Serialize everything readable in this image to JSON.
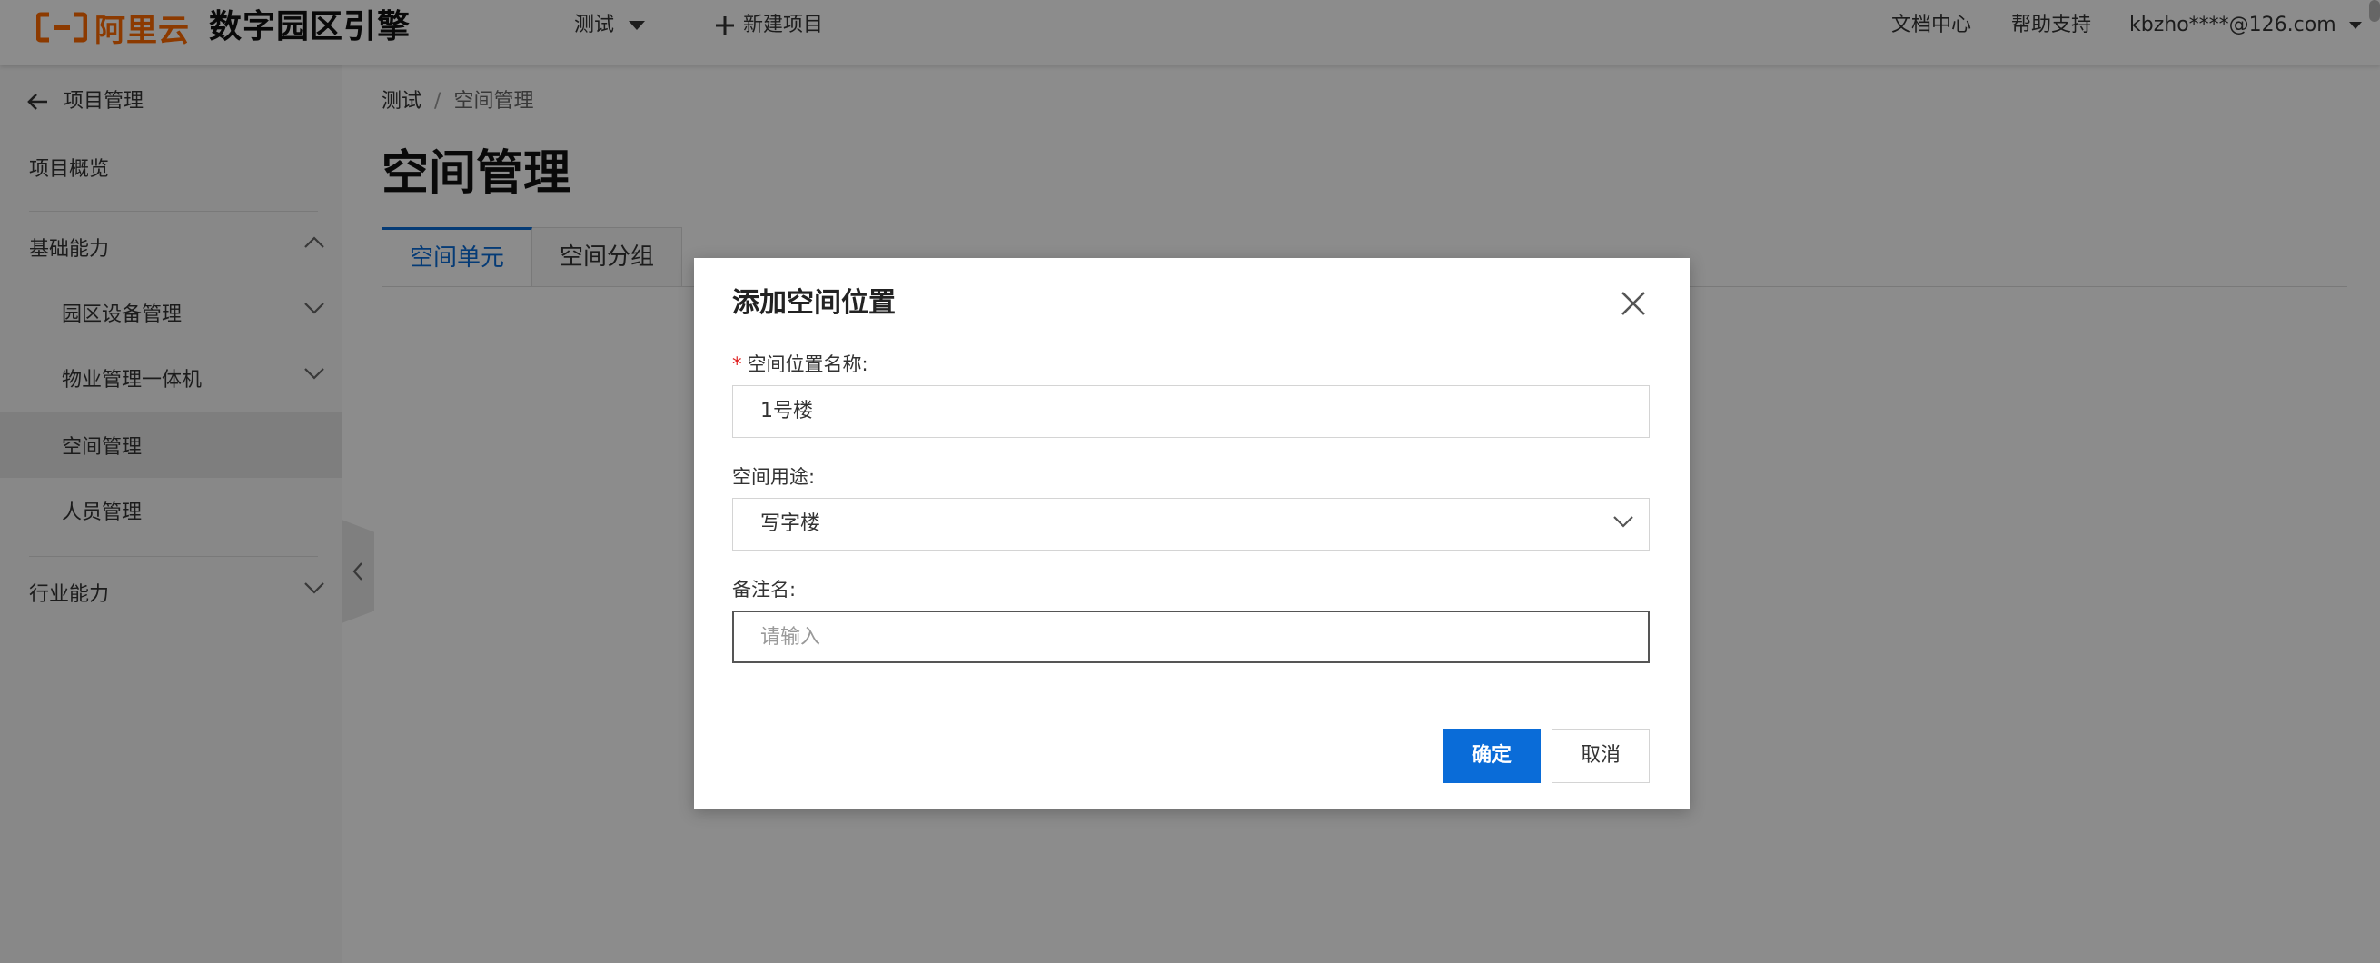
{
  "header": {
    "logo_text": "阿里云",
    "app_name": "数字园区引擎",
    "project_selector": "测试",
    "new_project": "新建项目",
    "links": [
      "文档中心",
      "帮助支持"
    ],
    "user": "kbzho****@126.com"
  },
  "sidebar": {
    "back_label": "项目管理",
    "items": [
      {
        "label": "项目概览"
      },
      {
        "label": "基础能力"
      },
      {
        "label": "园区设备管理"
      },
      {
        "label": "物业管理一体机"
      },
      {
        "label": "空间管理"
      },
      {
        "label": "人员管理"
      },
      {
        "label": "行业能力"
      }
    ]
  },
  "main": {
    "breadcrumb": [
      "测试",
      "/",
      "空间管理"
    ],
    "title": "空间管理",
    "tabs": [
      {
        "label": "空间单元"
      },
      {
        "label": "空间分组"
      }
    ]
  },
  "dialog": {
    "title": "添加空间位置",
    "fields": [
      {
        "required_mark": "*",
        "label": "空间位置名称:",
        "value": "1号楼"
      },
      {
        "label": "空间用途:",
        "value": "写字楼"
      },
      {
        "label": "备注名:",
        "value": "",
        "placeholder": "请输入"
      }
    ],
    "confirm": "确定",
    "cancel": "取消"
  },
  "colors": {
    "brand": "#ff6a00",
    "primary": "#0a6cd8",
    "required": "#e02020"
  },
  "icons": [
    "aliyun-logo-icon",
    "caret-down-icon",
    "plus-icon",
    "arrow-left-icon",
    "chevron-up-icon",
    "chevron-down-icon",
    "chevron-left-icon",
    "close-icon"
  ]
}
